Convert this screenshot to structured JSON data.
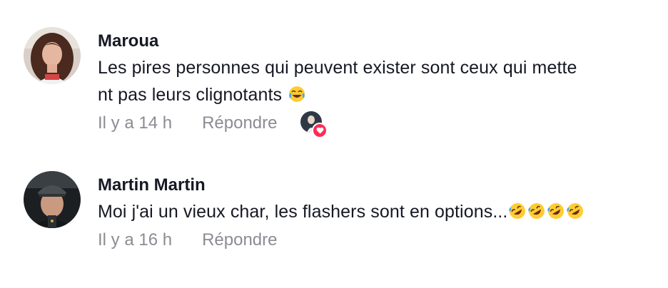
{
  "comments": [
    {
      "author": "Maroua",
      "text_line1": "Les pires personnes qui peuvent exister sont ceux qui mette",
      "text_line2": "nt pas leurs clignotants",
      "emoji": "face-with-tears-of-joy",
      "time": "Il y a 14 h",
      "reply_label": "Répondre",
      "liked_by_creator": true
    },
    {
      "author": "Martin Martin",
      "text": "Moi j'ai un vieux char, les flashers sont en options...",
      "emoji": "rolling-on-the-floor-laughing x4",
      "time": "Il y a 16 h",
      "reply_label": "Répondre",
      "liked_by_creator": false
    }
  ],
  "colors": {
    "text_primary": "#161823",
    "text_secondary": "#8a8b91",
    "heart": "#fe2c55"
  }
}
